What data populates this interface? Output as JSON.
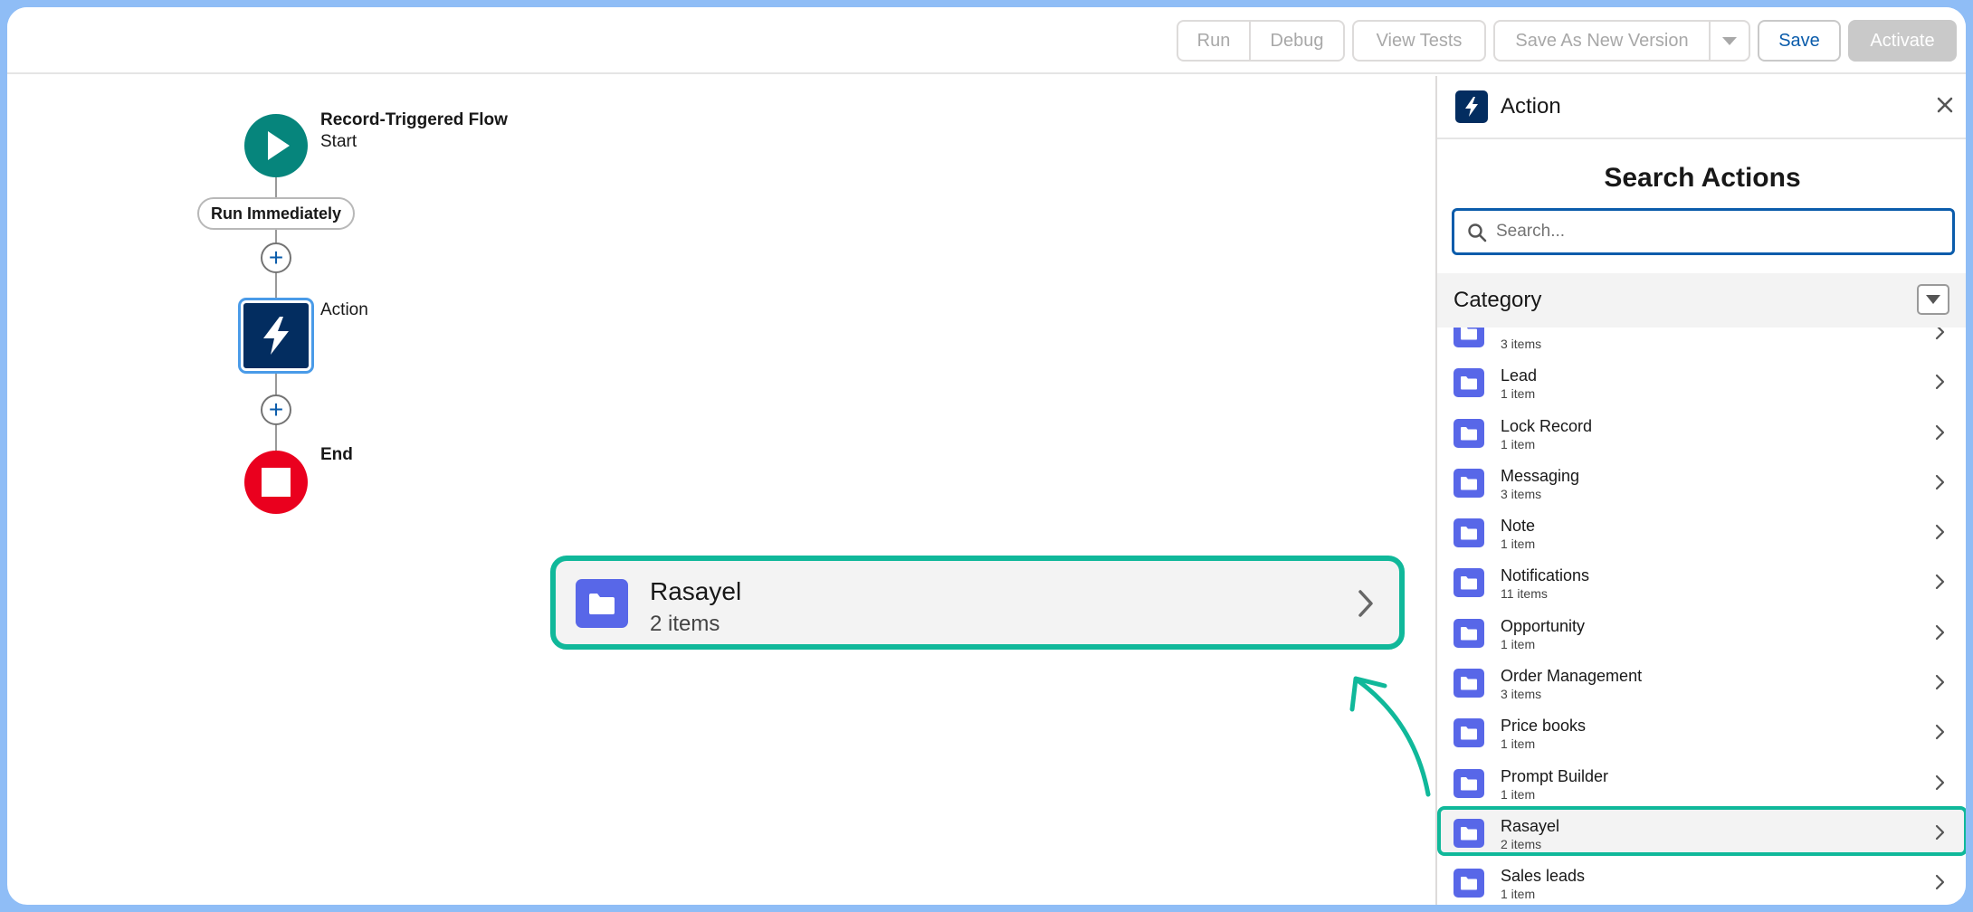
{
  "toolbar": {
    "run": "Run",
    "debug": "Debug",
    "view_tests": "View Tests",
    "save_as_new_version": "Save As New Version",
    "save": "Save",
    "activate": "Activate"
  },
  "flow": {
    "start_title": "Record-Triggered Flow",
    "start_subtitle": "Start",
    "run_pill": "Run Immediately",
    "action_label": "Action",
    "end_label": "End"
  },
  "zoom": {
    "name": "Rasayel",
    "count": "2 items"
  },
  "panel": {
    "title": "Action",
    "heading": "Search Actions",
    "search_placeholder": "Search...",
    "category_label": "Category",
    "items": [
      {
        "name": "",
        "count": "3 items"
      },
      {
        "name": "Lead",
        "count": "1 item"
      },
      {
        "name": "Lock Record",
        "count": "1 item"
      },
      {
        "name": "Messaging",
        "count": "3 items"
      },
      {
        "name": "Note",
        "count": "1 item"
      },
      {
        "name": "Notifications",
        "count": "11 items"
      },
      {
        "name": "Opportunity",
        "count": "1 item"
      },
      {
        "name": "Order Management",
        "count": "3 items"
      },
      {
        "name": "Price books",
        "count": "1 item"
      },
      {
        "name": "Prompt Builder",
        "count": "1 item"
      },
      {
        "name": "Rasayel",
        "count": "2 items"
      },
      {
        "name": "Sales leads",
        "count": "1 item"
      }
    ]
  },
  "colors": {
    "accent_highlight": "#10b89a",
    "folder": "#5867e8",
    "brand_dark": "#032d60",
    "start_green": "#06857c",
    "end_red": "#ea001e",
    "link_blue": "#0b5cab"
  }
}
